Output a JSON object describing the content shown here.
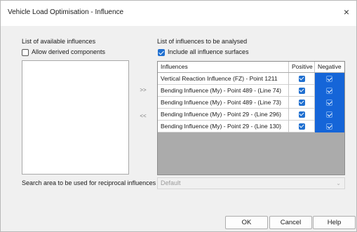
{
  "window": {
    "title": "Vehicle Load Optimisation - Influence",
    "close_glyph": "×"
  },
  "left": {
    "heading": "List of available influences",
    "allow_derived_label": "Allow derived components",
    "allow_derived_checked": false
  },
  "right": {
    "heading": "List of influences to be analysed",
    "include_all_label": "Include all influence surfaces",
    "include_all_checked": true
  },
  "arrows": {
    "add": ">>",
    "remove": "<<"
  },
  "table": {
    "headers": {
      "influences": "Influences",
      "positive": "Positive",
      "negative": "Negative"
    },
    "rows": [
      {
        "influence": "Vertical Reaction Influence (FZ) - Point 1211",
        "positive": true,
        "negative": true
      },
      {
        "influence": "Bending Influence (My) - Point 489 - (Line 74)",
        "positive": true,
        "negative": true
      },
      {
        "influence": "Bending Influence (My) - Point 489 - (Line 73)",
        "positive": true,
        "negative": true
      },
      {
        "influence": "Bending Influence (My) - Point 29 - (Line 296)",
        "positive": true,
        "negative": true
      },
      {
        "influence": "Bending Influence (My) - Point 29 - (Line 130)",
        "positive": true,
        "negative": true
      }
    ]
  },
  "search_area": {
    "label": "Search area to be used for reciprocal influences",
    "value": "Default"
  },
  "buttons": {
    "ok": "OK",
    "cancel": "Cancel",
    "help": "Help"
  },
  "colors": {
    "accent": "#1f6fd0",
    "selection": "#1565d8",
    "grid_empty": "#ababab"
  }
}
